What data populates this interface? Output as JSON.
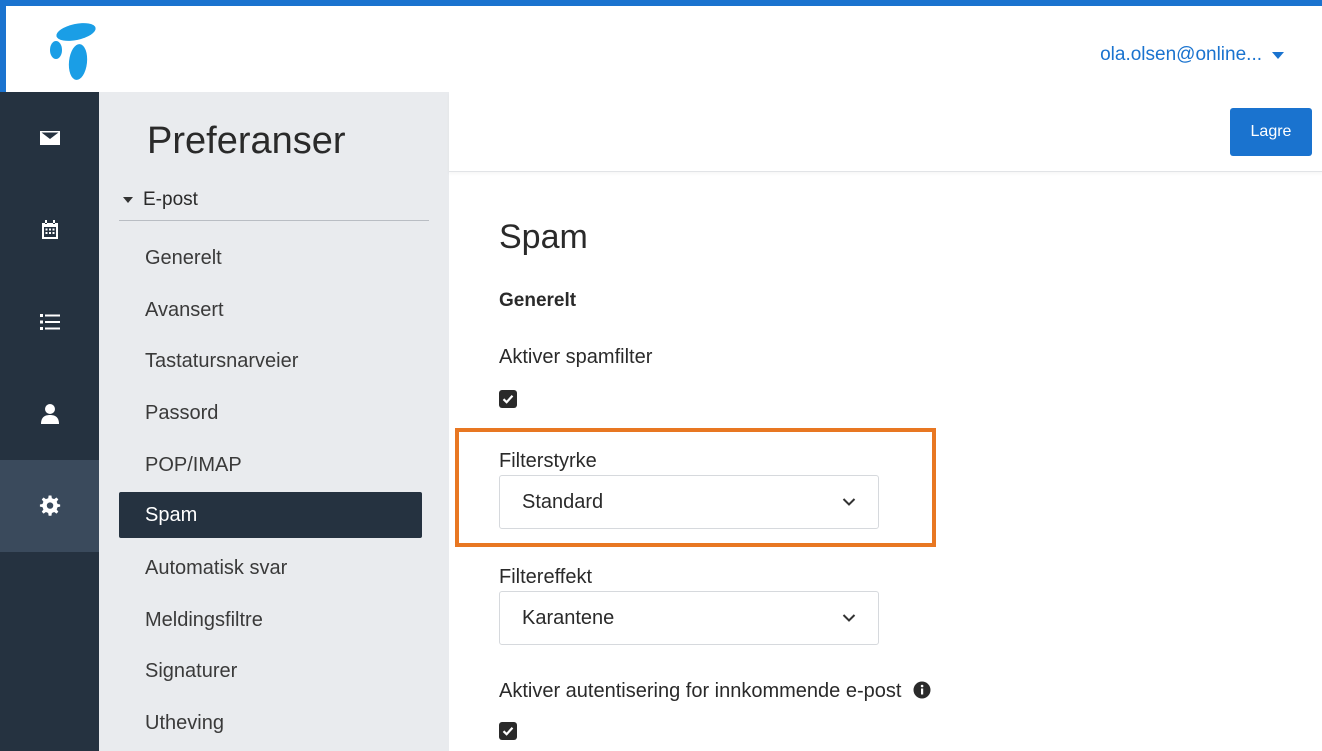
{
  "header": {
    "account_label": "ola.olsen@online...",
    "accent_color": "#1a73cf"
  },
  "rail": {
    "items": [
      {
        "icon": "envelope-icon"
      },
      {
        "icon": "calendar-icon"
      },
      {
        "icon": "list-icon"
      },
      {
        "icon": "person-icon"
      },
      {
        "icon": "gear-icon",
        "active": true
      }
    ],
    "bg_color": "#253240"
  },
  "preferences": {
    "title": "Preferanser",
    "section": "E-post",
    "items": [
      {
        "label": "Generelt"
      },
      {
        "label": "Avansert"
      },
      {
        "label": "Tastatursnarveier"
      },
      {
        "label": "Passord"
      },
      {
        "label": "POP/IMAP"
      },
      {
        "label": "Spam",
        "active": true
      },
      {
        "label": "Automatisk svar"
      },
      {
        "label": "Meldingsfiltre"
      },
      {
        "label": "Signaturer"
      },
      {
        "label": "Utheving"
      }
    ]
  },
  "toolbar": {
    "save_label": "Lagre"
  },
  "spam": {
    "heading": "Spam",
    "subheading": "Generelt",
    "enable_filter_label": "Aktiver spamfilter",
    "enable_filter_checked": true,
    "filter_strength_label": "Filterstyrke",
    "filter_strength_value": "Standard",
    "filter_effect_label": "Filtereffekt",
    "filter_effect_value": "Karantene",
    "auth_label": "Aktiver autentisering for innkommende e-post",
    "auth_checked": true,
    "highlight_color": "#e87722"
  }
}
